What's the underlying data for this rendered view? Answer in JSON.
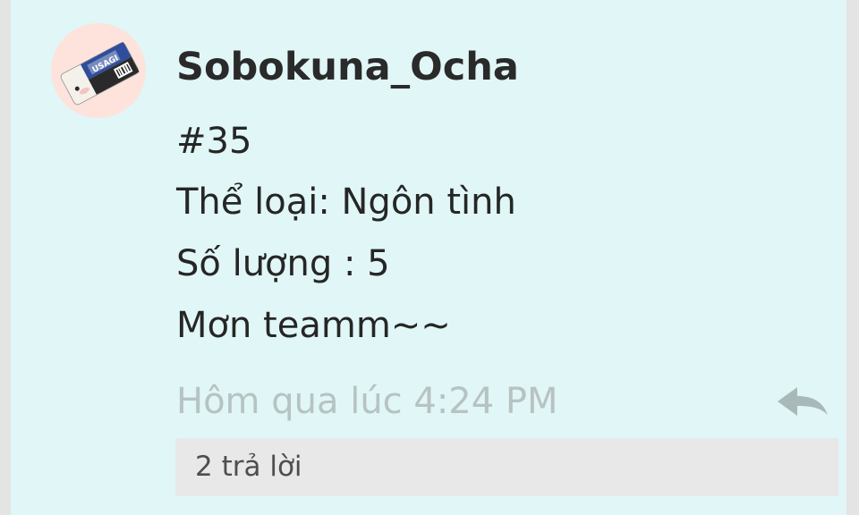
{
  "post": {
    "author": "Sobokuna_Ocha",
    "avatar_icon": "usagi-eraser-avatar",
    "avatar_text": "USAGI",
    "lines": [
      "#35",
      "Thể loại: Ngôn tình",
      "Số lượng : 5",
      "Mơn teamm~~"
    ],
    "timestamp": "Hôm qua lúc 4:24 PM",
    "reply_icon": "reply-arrow-icon",
    "replies_label": "2 trả lời"
  },
  "colors": {
    "card_background": "#e1f6f6",
    "page_background": "#e4e4e4",
    "text": "#262626",
    "timestamp": "#b7c3c3",
    "reply_icon": "#a9b9b9",
    "replies_bar": "#e8e8e8"
  }
}
